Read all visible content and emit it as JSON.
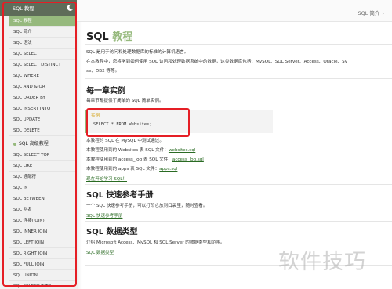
{
  "sidebar": {
    "title": "SQL 教程",
    "items": [
      {
        "label": "SQL 教程",
        "active": true
      },
      {
        "label": "SQL 简介"
      },
      {
        "label": "SQL 语法"
      },
      {
        "label": "SQL SELECT"
      },
      {
        "label": "SQL SELECT DISTINCT"
      },
      {
        "label": "SQL WHERE"
      },
      {
        "label": "SQL AND & OR"
      },
      {
        "label": "SQL ORDER BY"
      },
      {
        "label": "SQL INSERT INTO"
      },
      {
        "label": "SQL UPDATE"
      },
      {
        "label": "SQL DELETE"
      }
    ],
    "section_title": "SQL 高级教程",
    "advanced_items": [
      {
        "label": "SQL SELECT TOP"
      },
      {
        "label": "SQL LIKE"
      },
      {
        "label": "SQL 通配符"
      },
      {
        "label": "SQL IN"
      },
      {
        "label": "SQL BETWEEN"
      },
      {
        "label": "SQL 别名"
      },
      {
        "label": "SQL 连接(JOIN)"
      },
      {
        "label": "SQL INNER JOIN"
      },
      {
        "label": "SQL LEFT JOIN"
      },
      {
        "label": "SQL RIGHT JOIN"
      },
      {
        "label": "SQL FULL JOIN"
      },
      {
        "label": "SQL UNION"
      },
      {
        "label": "SQL SELECT INTO"
      }
    ]
  },
  "header": {
    "breadcrumb": "SQL 简介",
    "breadcrumb_icon": "›"
  },
  "main": {
    "title_prefix": "SQL",
    "title_suffix": " 教程",
    "intro": "SQL 是用于访问和处理数据库的标准的计算机语言。",
    "intro2_a": "在本教程中，您将学到如何使用 SQL 访问和处理数据系统中的数据，这类数据库包括：MySQL、SQL Server、Access、Oracle、Sy",
    "intro2_b": "se、DB2 等等。",
    "section1_title": "每一章实例",
    "section1_desc": "每章节都提供了简单的 SQL 简单实例。",
    "example_label": "实例",
    "example_code": "SELECT * FROM Websites;",
    "note1": "本教程的 SQL 在 MySQL 中测试通过。",
    "note2_text": "本教程使用到的 Websites 表 SQL 文件：",
    "note2_link": "websites.sql",
    "note3_text": "本教程使用到的 access_log 表 SQL 文件：",
    "note3_link": "access_log.sql",
    "note4_text": "本教程使用到的 apps 表 SQL 文件：",
    "note4_link": "apps.sql",
    "start_link": "现在开始学习 SQL！",
    "section2_title": "SQL 快速参考手册",
    "section2_desc": "一个 SQL 快速参考手册，可以打印它放到口袋里，随时查看。",
    "section2_link": "SQL 快速参考手册",
    "section3_title": "SQL 数据类型",
    "section3_desc": "介绍 Microsoft Access、MySQL 和 SQL Server 的数据类型和范围。",
    "section3_link": "SQL 数据类型"
  },
  "watermark": "软件技巧",
  "colors": {
    "accent": "#96b97d",
    "highlight": "#e51e25",
    "header_bg": "#5e6c59"
  }
}
